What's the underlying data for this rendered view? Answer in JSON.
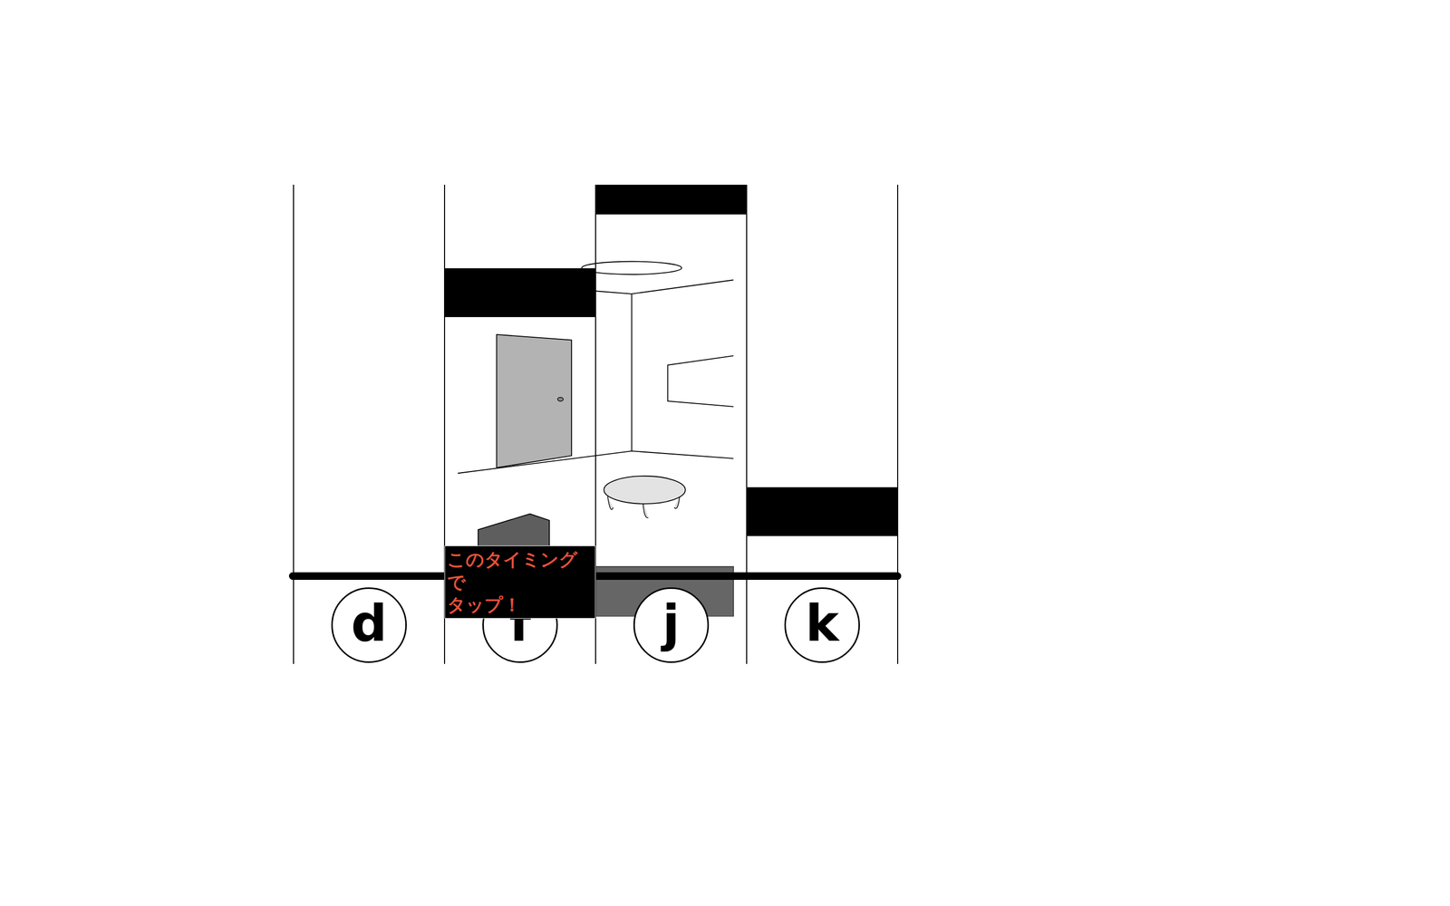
{
  "lanes": [
    {
      "key": "d",
      "notes": []
    },
    {
      "key": "f",
      "notes": [
        {
          "level": 0.338
        }
      ]
    },
    {
      "key": "j",
      "notes": [
        {
          "level": 0.076
        }
      ]
    },
    {
      "key": "k",
      "notes": [
        {
          "level": 0.898
        }
      ]
    }
  ],
  "hint": {
    "text": "このタイミングで\nタップ！",
    "lane": 1
  }
}
